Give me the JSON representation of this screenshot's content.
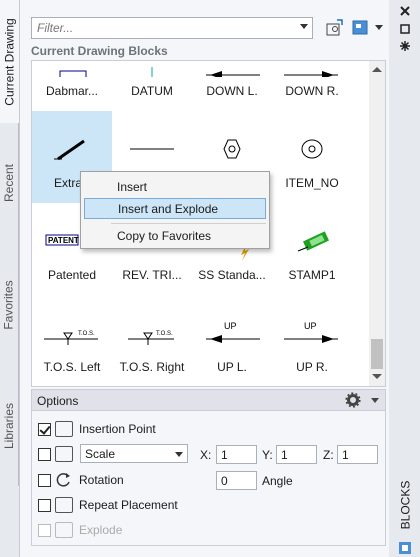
{
  "left_tabs": [
    "Current Drawing",
    "Recent",
    "Favorites",
    "Libraries"
  ],
  "filter": {
    "placeholder": "Filter..."
  },
  "section_title": "Current Drawing Blocks",
  "blocks": [
    "Dabmar...",
    "DATUM",
    "DOWN L.",
    "DOWN R.",
    "Extra",
    "",
    "",
    "ITEM_NO",
    "Patented",
    "REV. TRI...",
    "SS Standa...",
    "STAMP1",
    "T.O.S. Left",
    "T.O.S. Right",
    "UP L.",
    "UP R."
  ],
  "context_menu": [
    "Insert",
    "Insert and Explode",
    "Copy to Favorites"
  ],
  "options": {
    "title": "Options",
    "insertion_point": "Insertion Point",
    "scale": "Scale",
    "scale_value": "Scale",
    "x_label": "X:",
    "y_label": "Y:",
    "z_label": "Z:",
    "x": "1",
    "y": "1",
    "z": "1",
    "rotation": "Rotation",
    "angle": "0",
    "angle_label": "Angle",
    "repeat": "Repeat Placement",
    "explode": "Explode"
  },
  "right_tab": "BLOCKS",
  "symbol_text": {
    "patent": "PATENT",
    "up": "UP",
    "tos_left": "T.O.S.",
    "tos_right": "T.O.S."
  }
}
